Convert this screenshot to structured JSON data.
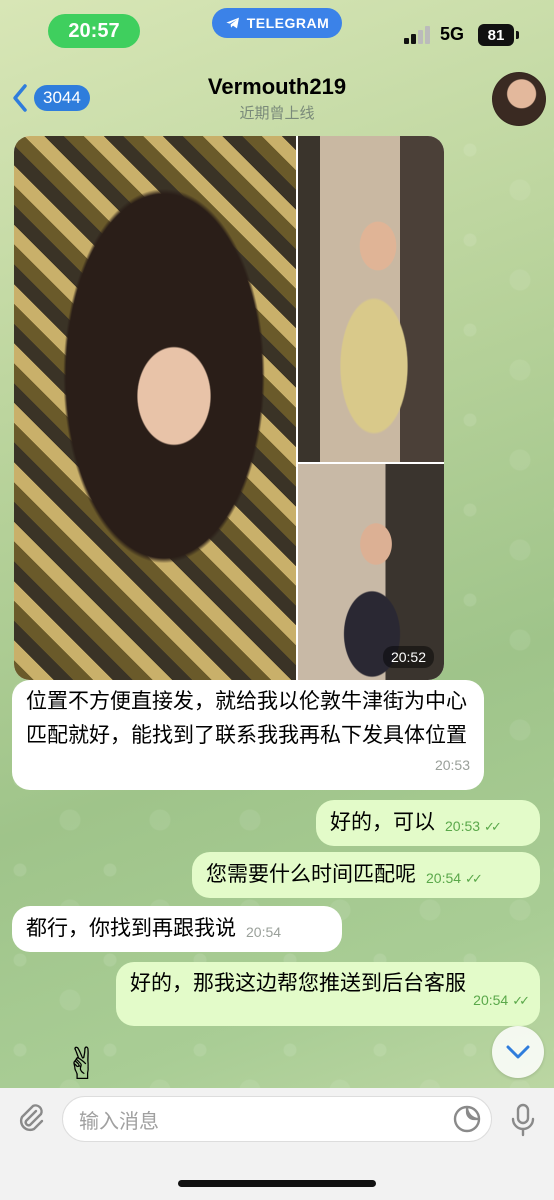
{
  "status_bar": {
    "time": "20:57",
    "app_pill": "TELEGRAM",
    "network": "5G",
    "battery": "81"
  },
  "header": {
    "back_count": "3044",
    "chat_name": "Vermouth219",
    "status": "近期曾上线"
  },
  "album": {
    "time": "20:52"
  },
  "messages": [
    {
      "direction": "incoming",
      "text": "位置不方便直接发，就给我以伦敦牛津街为中心匹配就好，能找到了联系我我再私下发具体位置",
      "time": "20:53"
    },
    {
      "direction": "outgoing",
      "text": "好的，可以",
      "time": "20:53"
    },
    {
      "direction": "outgoing",
      "text": "您需要什么时间匹配呢",
      "time": "20:54"
    },
    {
      "direction": "incoming",
      "text": "都行，你找到再跟我说",
      "time": "20:54"
    },
    {
      "direction": "outgoing",
      "text": "好的，那我这边帮您推送到后台客服",
      "time": "20:54"
    }
  ],
  "input": {
    "placeholder": "输入消息"
  },
  "colors": {
    "incoming_bubble": "#ffffff",
    "outgoing_bubble": "#e3fbc9",
    "read_check": "#5aa84a",
    "accent": "#2f7ddc"
  }
}
